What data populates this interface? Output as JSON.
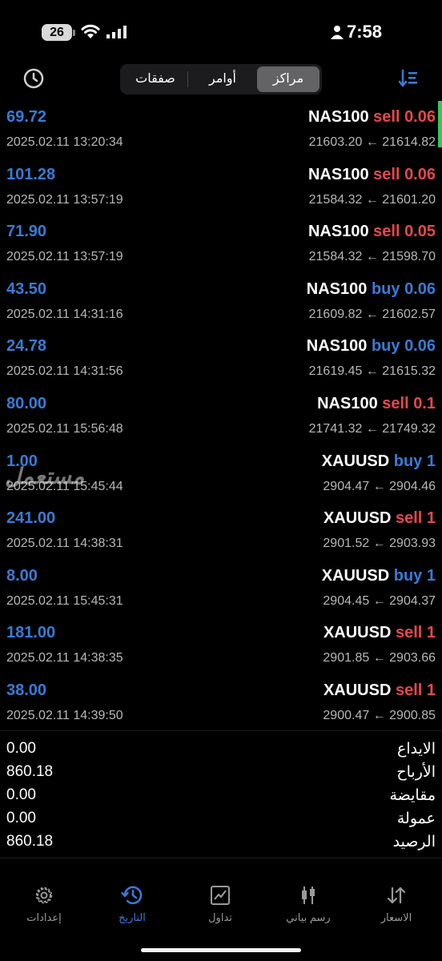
{
  "status_bar": {
    "time": "7:58",
    "battery": "26"
  },
  "header": {
    "segments": [
      {
        "label": "مراكز",
        "active": true
      },
      {
        "label": "أوامر",
        "active": false
      },
      {
        "label": "صفقات",
        "active": false
      }
    ]
  },
  "positions": [
    {
      "profit": "69.72",
      "time": "2025.02.11 13:20:34",
      "symbol": "NAS100",
      "side": "sell",
      "volume": "0.06",
      "open_price": "21614.82",
      "close_price": "21603.20"
    },
    {
      "profit": "101.28",
      "time": "2025.02.11 13:57:19",
      "symbol": "NAS100",
      "side": "sell",
      "volume": "0.06",
      "open_price": "21601.20",
      "close_price": "21584.32"
    },
    {
      "profit": "71.90",
      "time": "2025.02.11 13:57:19",
      "symbol": "NAS100",
      "side": "sell",
      "volume": "0.05",
      "open_price": "21598.70",
      "close_price": "21584.32"
    },
    {
      "profit": "43.50",
      "time": "2025.02.11 14:31:16",
      "symbol": "NAS100",
      "side": "buy",
      "volume": "0.06",
      "open_price": "21602.57",
      "close_price": "21609.82"
    },
    {
      "profit": "24.78",
      "time": "2025.02.11 14:31:56",
      "symbol": "NAS100",
      "side": "buy",
      "volume": "0.06",
      "open_price": "21615.32",
      "close_price": "21619.45"
    },
    {
      "profit": "80.00",
      "time": "2025.02.11 15:56:48",
      "symbol": "NAS100",
      "side": "sell",
      "volume": "0.1",
      "open_price": "21749.32",
      "close_price": "21741.32"
    },
    {
      "profit": "1.00",
      "time": "2025.02.11 15:45:44",
      "symbol": "XAUUSD",
      "side": "buy",
      "volume": "1",
      "open_price": "2904.46",
      "close_price": "2904.47"
    },
    {
      "profit": "241.00",
      "time": "2025.02.11 14:38:31",
      "symbol": "XAUUSD",
      "side": "sell",
      "volume": "1",
      "open_price": "2903.93",
      "close_price": "2901.52"
    },
    {
      "profit": "8.00",
      "time": "2025.02.11 15:45:31",
      "symbol": "XAUUSD",
      "side": "buy",
      "volume": "1",
      "open_price": "2904.37",
      "close_price": "2904.45"
    },
    {
      "profit": "181.00",
      "time": "2025.02.11 14:38:35",
      "symbol": "XAUUSD",
      "side": "sell",
      "volume": "1",
      "open_price": "2903.66",
      "close_price": "2901.85"
    },
    {
      "profit": "38.00",
      "time": "2025.02.11 14:39:50",
      "symbol": "XAUUSD",
      "side": "sell",
      "volume": "1",
      "open_price": "2900.85",
      "close_price": "2900.47"
    }
  ],
  "summary": [
    {
      "label": "الايداع",
      "value": "0.00"
    },
    {
      "label": "الأرباح",
      "value": "860.18"
    },
    {
      "label": "مقايضة",
      "value": "0.00"
    },
    {
      "label": "عمولة",
      "value": "0.00"
    },
    {
      "label": "الرصيد",
      "value": "860.18"
    }
  ],
  "tabs": [
    {
      "label": "الاسعار",
      "icon": "arrows-updown-icon"
    },
    {
      "label": "رسم بياني",
      "icon": "candlestick-icon"
    },
    {
      "label": "تداول",
      "icon": "line-chart-icon"
    },
    {
      "label": "التاريخ",
      "icon": "history-icon",
      "active": true
    },
    {
      "label": "إعدادات",
      "icon": "gear-icon"
    }
  ],
  "watermark": "مستعمل",
  "colors": {
    "sell": "#e5484d",
    "buy": "#3a7bd5",
    "profit": "#3a7bd5",
    "active_tab": "#3a7bd5",
    "open_indicator": "#34c759"
  }
}
